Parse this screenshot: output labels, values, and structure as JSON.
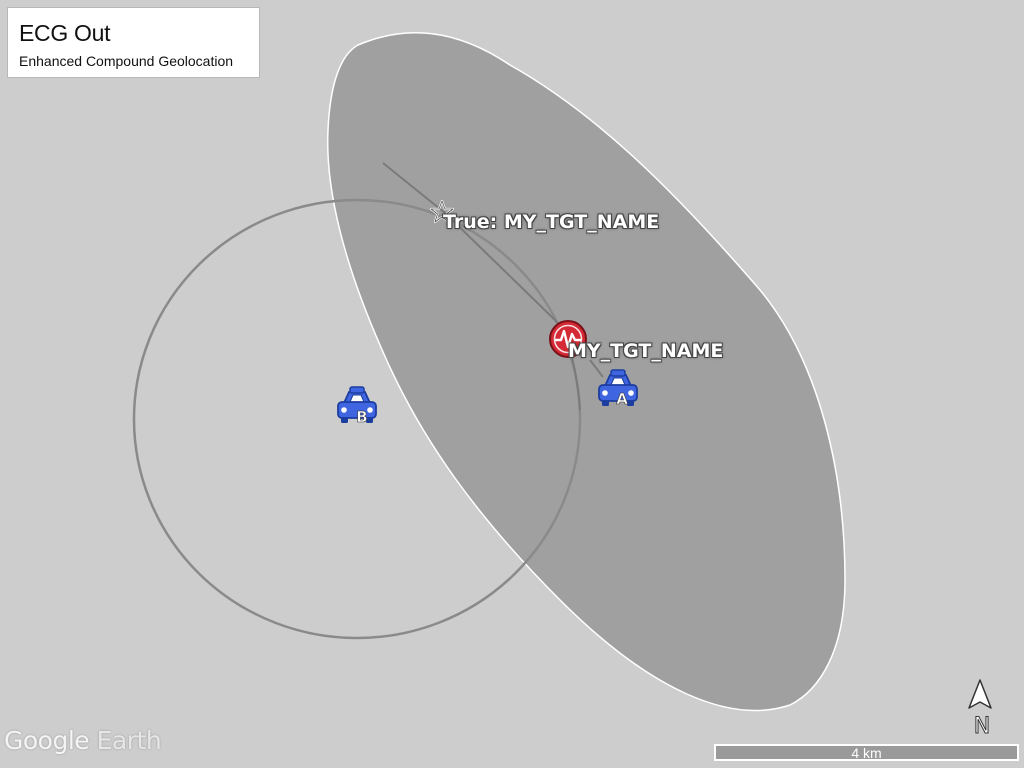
{
  "legend": {
    "title": "ECG Out",
    "subtitle": "Enhanced Compound Geolocation"
  },
  "labels": {
    "true_target": "True: MY_TGT_NAME",
    "estimated_target": "MY_TGT_NAME"
  },
  "sensors": {
    "a": {
      "letter": "A",
      "icon": "car-icon"
    },
    "b": {
      "letter": "B",
      "icon": "car-icon"
    }
  },
  "markers": {
    "true_target_icon": "star-icon",
    "estimated_target_icon": "signal-icon"
  },
  "watermark": {
    "part1": "Google",
    "part2": " Earth"
  },
  "scale": {
    "label": "4 km"
  },
  "compass": {
    "letter": "N",
    "icon": "north-arrow-icon"
  },
  "colors": {
    "background": "#cdcdcd",
    "ellipse_fill": "#a0a0a0",
    "ellipse_stroke": "#ffffff",
    "circle_stroke": "#8a8a8a",
    "car_blue": "#3f66e0",
    "target_red": "#d42a35"
  }
}
